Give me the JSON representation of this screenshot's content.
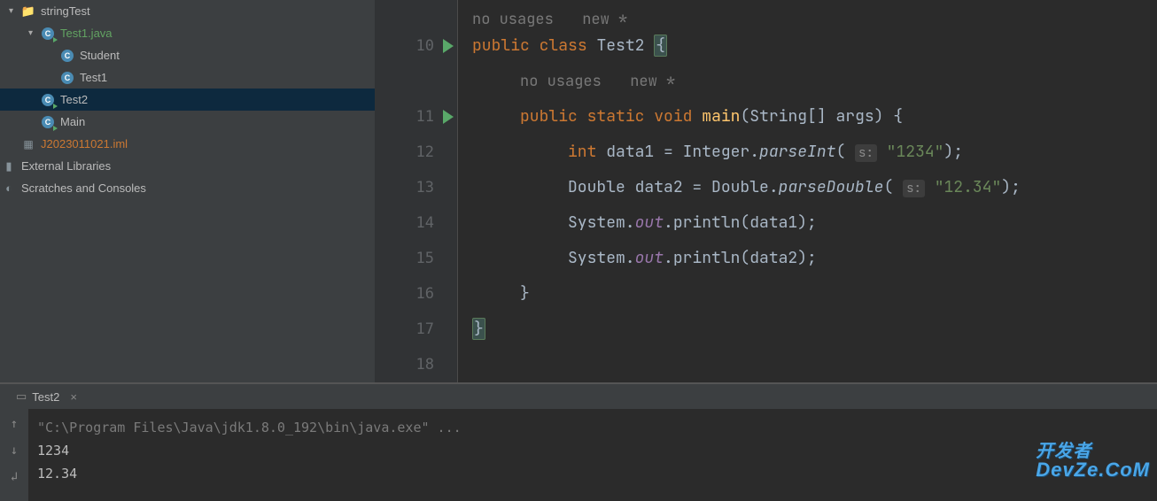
{
  "sidebar": {
    "items": [
      {
        "label": "stringTest",
        "indent": 0,
        "type": "folder",
        "arrow": "▾"
      },
      {
        "label": "Test1.java",
        "indent": 1,
        "type": "java-file",
        "arrow": "▾",
        "color": "java"
      },
      {
        "label": "Student",
        "indent": 2,
        "type": "class"
      },
      {
        "label": "Test1",
        "indent": 2,
        "type": "class"
      },
      {
        "label": "Test2",
        "indent": 1,
        "type": "class-run",
        "selected": true
      },
      {
        "label": "Main",
        "indent": 1,
        "type": "class-run"
      },
      {
        "label": "J2023011021.iml",
        "indent": 0,
        "type": "iml",
        "color": "iml"
      },
      {
        "label": "External Libraries",
        "indent": -1,
        "type": "lib"
      },
      {
        "label": "Scratches and Consoles",
        "indent": -1,
        "type": "scratch"
      }
    ]
  },
  "editor": {
    "hints": {
      "no_usages": "no usages",
      "new": "new *"
    },
    "lines": [
      {
        "num": "",
        "run": false
      },
      {
        "num": "10",
        "run": true
      },
      {
        "num": "",
        "run": false
      },
      {
        "num": "11",
        "run": true
      },
      {
        "num": "12",
        "run": false
      },
      {
        "num": "13",
        "run": false
      },
      {
        "num": "14",
        "run": false
      },
      {
        "num": "15",
        "run": false
      },
      {
        "num": "16",
        "run": false
      },
      {
        "num": "17",
        "run": false
      },
      {
        "num": "18",
        "run": false
      }
    ],
    "tokens": {
      "public": "public",
      "class": "class",
      "Test2": "Test2",
      "static": "static",
      "void": "void",
      "main": "main",
      "String_args": "(String[] args) {",
      "int": "int",
      "data1": "data1",
      "eq": " = ",
      "Integer": "Integer.",
      "parseInt": "parseInt",
      "s_hint": "s:",
      "s1234": "\"1234\"",
      "close_paren_semi": ");",
      "Double": "Double",
      "data2": "data2",
      "Double2": "Double.",
      "parseDouble": "parseDouble",
      "s1234b": "\"12.34\"",
      "System": "System.",
      "out": "out",
      "println": ".println(data1);",
      "println2": ".println(data2);",
      "rbrace": "}",
      "rbrace2": "}"
    }
  },
  "run": {
    "tab_label": "Test2",
    "cmd": "\"C:\\Program Files\\Java\\jdk1.8.0_192\\bin\\java.exe\" ...",
    "out1": "1234",
    "out2": "12.34"
  },
  "watermark": {
    "line1": "开发者",
    "line2": "DevZe.CoM"
  }
}
